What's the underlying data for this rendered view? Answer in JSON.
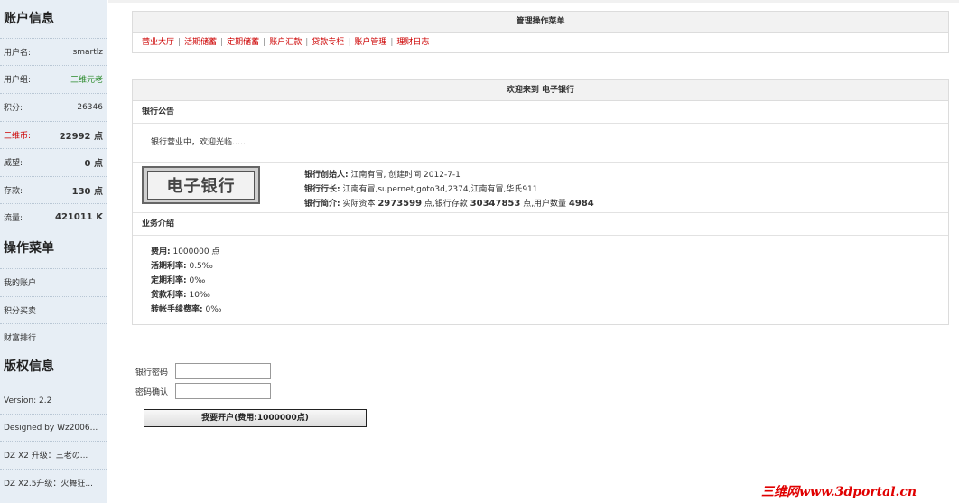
{
  "sidebar": {
    "account_title": "账户信息",
    "username_label": "用户名:",
    "username": "smartlz",
    "group_label": "用户组:",
    "group": "三维元老",
    "points_label": "积分:",
    "points": "26346",
    "coins_label": "三维币:",
    "coins": "22992 点",
    "prestige_label": "威望:",
    "prestige": "0 点",
    "deposit_label": "存款:",
    "deposit": "130 点",
    "traffic_label": "流量:",
    "traffic": "421011 K",
    "ops_title": "操作菜单",
    "ops": [
      "我的账户",
      "积分买卖",
      "财富排行"
    ],
    "copyright_title": "版权信息",
    "copyright": [
      "Version: 2.2",
      "Designed by Wz2006...",
      "DZ X2 升级：三老の...",
      "DZ X2.5升级：火舞狂..."
    ]
  },
  "menu": {
    "title": "管理操作菜单",
    "items": [
      "营业大厅",
      "活期储蓄",
      "定期储蓄",
      "账户汇款",
      "贷款专柜",
      "账户管理",
      "理财日志"
    ],
    "separator": "|"
  },
  "bank": {
    "welcome": "欢迎来到  电子银行",
    "notice_title": "银行公告",
    "notice": "银行营业中，欢迎光临……",
    "logo_text": "电子银行",
    "founder_label": "银行创始人:",
    "founder_value": " 江南有冒, 创建时间  2012-7-1",
    "president_label": "银行行长:",
    "president_value": " 江南有冒,supernet,goto3d,2374,江南有冒,华氏911",
    "intro_label": "银行简介:",
    "intro_capital_pre": " 实际资本 ",
    "intro_capital": "2973599",
    "intro_deposit_pre": " 点,银行存款 ",
    "intro_deposit": "30347853",
    "intro_users_pre": " 点,用户数量 ",
    "intro_users": "4984",
    "biz_title": "业务介绍",
    "biz": [
      {
        "label": "费用:",
        "value": " 1000000 点"
      },
      {
        "label": "活期利率:",
        "value": " 0.5‰"
      },
      {
        "label": "定期利率:",
        "value": " 0‰"
      },
      {
        "label": "贷款利率:",
        "value": " 10‰"
      },
      {
        "label": "转帐手续费率:",
        "value": " 0‰"
      }
    ]
  },
  "form": {
    "password_label": "银行密码",
    "confirm_label": "密码确认",
    "submit": "我要开户(费用:1000000点)"
  },
  "watermark": "三维网www.3dportal.cn",
  "colors": {
    "sidebar_bg": "#e7eef5",
    "link_red": "#cc0000",
    "group_green": "#2a8a2a",
    "watermark_red": "#e00000"
  }
}
